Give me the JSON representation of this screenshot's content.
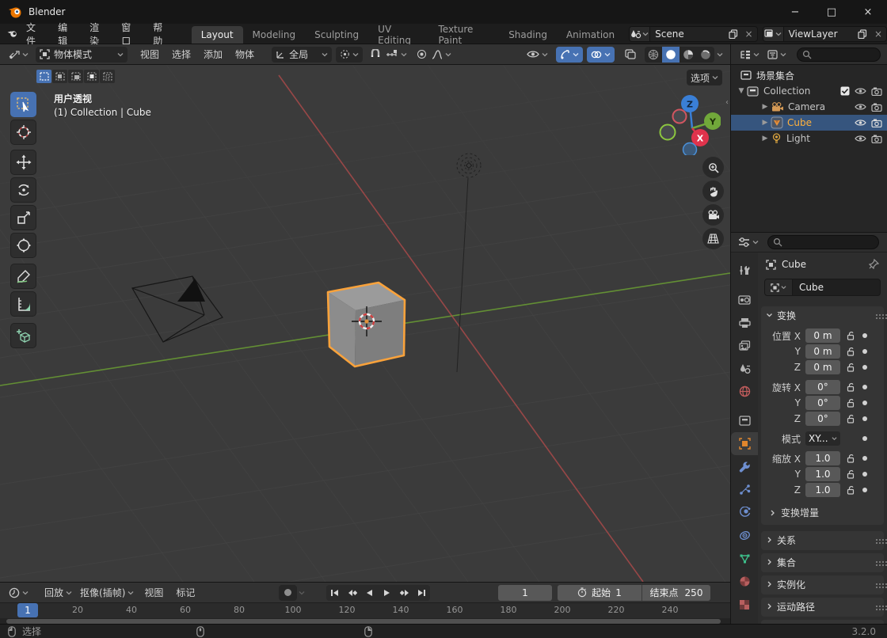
{
  "window": {
    "title": "Blender",
    "minimize": "−",
    "maximize": "□",
    "close": "×"
  },
  "menubar": {
    "menus": [
      {
        "label": "文件"
      },
      {
        "label": "编辑"
      },
      {
        "label": "渲染"
      },
      {
        "label": "窗口"
      },
      {
        "label": "帮助"
      }
    ],
    "workspaces": [
      {
        "label": "Layout"
      },
      {
        "label": "Modeling"
      },
      {
        "label": "Sculpting"
      },
      {
        "label": "UV Editing"
      },
      {
        "label": "Texture Paint"
      },
      {
        "label": "Shading"
      },
      {
        "label": "Animation"
      }
    ],
    "scene_selector": {
      "value": "Scene"
    },
    "view_layer_selector": {
      "value": "ViewLayer"
    }
  },
  "tool_header": {
    "mode": "物体模式",
    "menus": [
      {
        "label": "视图"
      },
      {
        "label": "选择"
      },
      {
        "label": "添加"
      },
      {
        "label": "物体"
      }
    ],
    "orientation": "全局"
  },
  "viewport": {
    "options_label": "选项",
    "view_label": "用户透视",
    "context_label": "(1) Collection | Cube",
    "axis": {
      "x": "X",
      "y": "Y",
      "z": "Z"
    }
  },
  "outliner": {
    "root_label": "场景集合",
    "rows": [
      {
        "label": "Collection"
      },
      {
        "label": "Camera"
      },
      {
        "label": "Cube"
      },
      {
        "label": "Light"
      }
    ]
  },
  "properties": {
    "breadcrumb": "Cube",
    "name_value": "Cube",
    "transform": {
      "title": "变换",
      "rows": [
        {
          "label": "位置 X",
          "value": "0 m"
        },
        {
          "label": "Y",
          "value": "0 m"
        },
        {
          "label": "Z",
          "value": "0 m"
        },
        {
          "label": "旋转 X",
          "value": "0°"
        },
        {
          "label": "Y",
          "value": "0°"
        },
        {
          "label": "Z",
          "value": "0°"
        },
        {
          "label": "模式",
          "value": "XY..."
        },
        {
          "label": "缩放 X",
          "value": "1.0"
        },
        {
          "label": "Y",
          "value": "1.0"
        },
        {
          "label": "Z",
          "value": "1.0"
        }
      ],
      "subpanel": "变换增量"
    },
    "panels": [
      {
        "label": "关系"
      },
      {
        "label": "集合"
      },
      {
        "label": "实例化"
      },
      {
        "label": "运动路径"
      }
    ]
  },
  "timeline": {
    "menus": [
      {
        "label": "回放"
      },
      {
        "label": "抠像(插帧)"
      },
      {
        "label": "视图"
      },
      {
        "label": "标记"
      }
    ],
    "current_frame": "1",
    "playhead": "1",
    "start_label": "起始",
    "start_value": "1",
    "end_label": "结束点",
    "end_value": "250",
    "ticks": [
      "20",
      "40",
      "60",
      "80",
      "100",
      "120",
      "140",
      "160",
      "180",
      "200",
      "220",
      "240"
    ]
  },
  "statusbar": {
    "left_action": "选择",
    "version": "3.2.0"
  },
  "colors": {
    "accent_blue": "#4772b3",
    "selection_orange": "#f9a23b",
    "axis_x": "#b04a4a",
    "axis_y": "#6a9e33"
  }
}
